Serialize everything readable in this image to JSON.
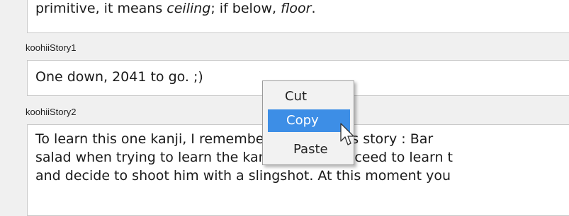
{
  "fields": [
    {
      "text_parts": [
        "primitive, it means ",
        "ceiling",
        "; if below, ",
        "floor",
        "."
      ]
    },
    {
      "label": "koohiiStory1",
      "text": "One down, 2041 to go. ;)"
    },
    {
      "label": "koohiiStory2",
      "lines": [
        "To learn this one kanji, I remember (#2000) this story : Bar",
        "salad when trying to learn the kanjis. As he succeed to learn t",
        "and decide to shoot him with a slingshot. At this moment you"
      ]
    }
  ],
  "context_menu": {
    "items": [
      {
        "label": "Cut",
        "highlighted": false
      },
      {
        "label": "Copy",
        "highlighted": true
      },
      {
        "label": "Paste",
        "highlighted": false
      }
    ],
    "highlight_color": "#3d8ee6"
  },
  "cursor_icon": "arrow-pointer-icon"
}
